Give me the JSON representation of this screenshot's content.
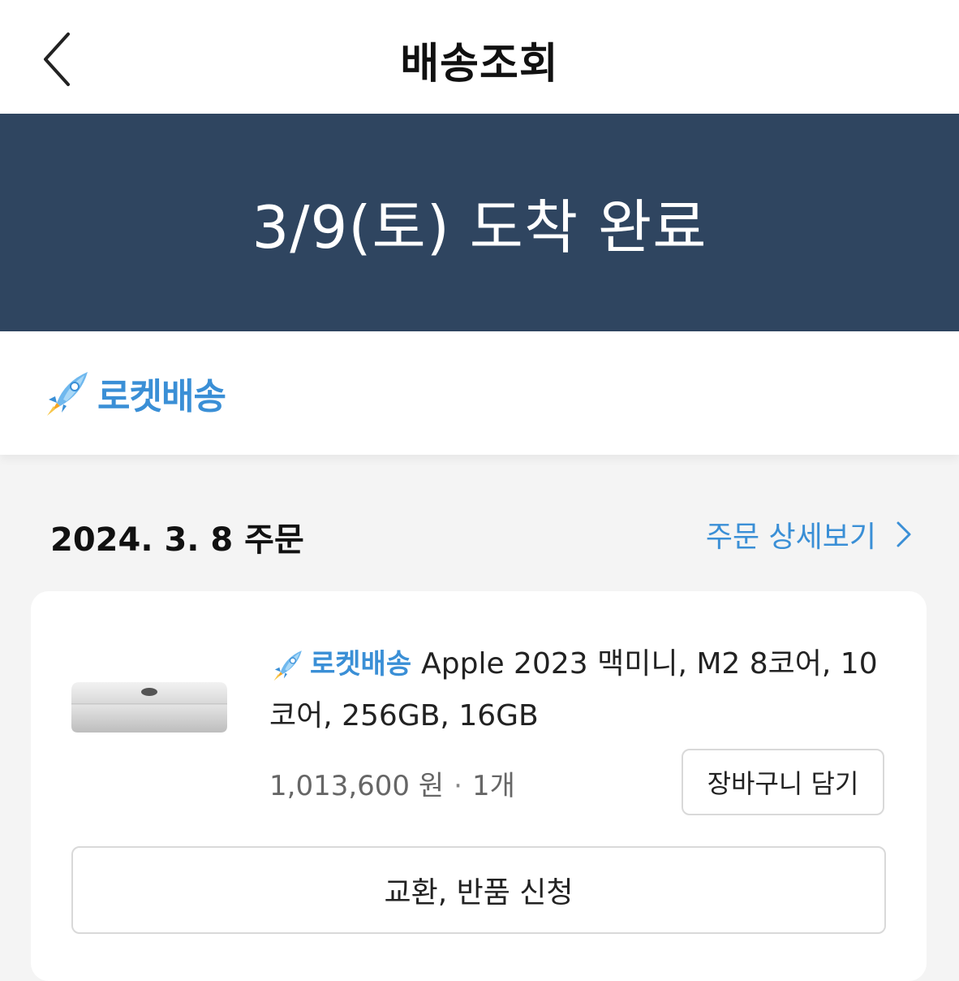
{
  "header": {
    "title": "배송조회"
  },
  "banner": {
    "status": "3/9(토) 도착 완료"
  },
  "delivery": {
    "badge_label": "로켓배송"
  },
  "order": {
    "date_label": "2024. 3. 8 주문",
    "detail_link": "주문 상세보기"
  },
  "product": {
    "badge_label": "로켓배송",
    "name": "Apple 2023 맥미니, M2 8코어, 10코어, 256GB, 16GB",
    "price": "1,013,600 원",
    "separator": "·",
    "quantity": "1개",
    "cart_button": "장바구니 담기",
    "return_button": "교환, 반품 신청"
  },
  "colors": {
    "banner_bg": "#2f4560",
    "accent_blue": "#3a8fd6"
  }
}
